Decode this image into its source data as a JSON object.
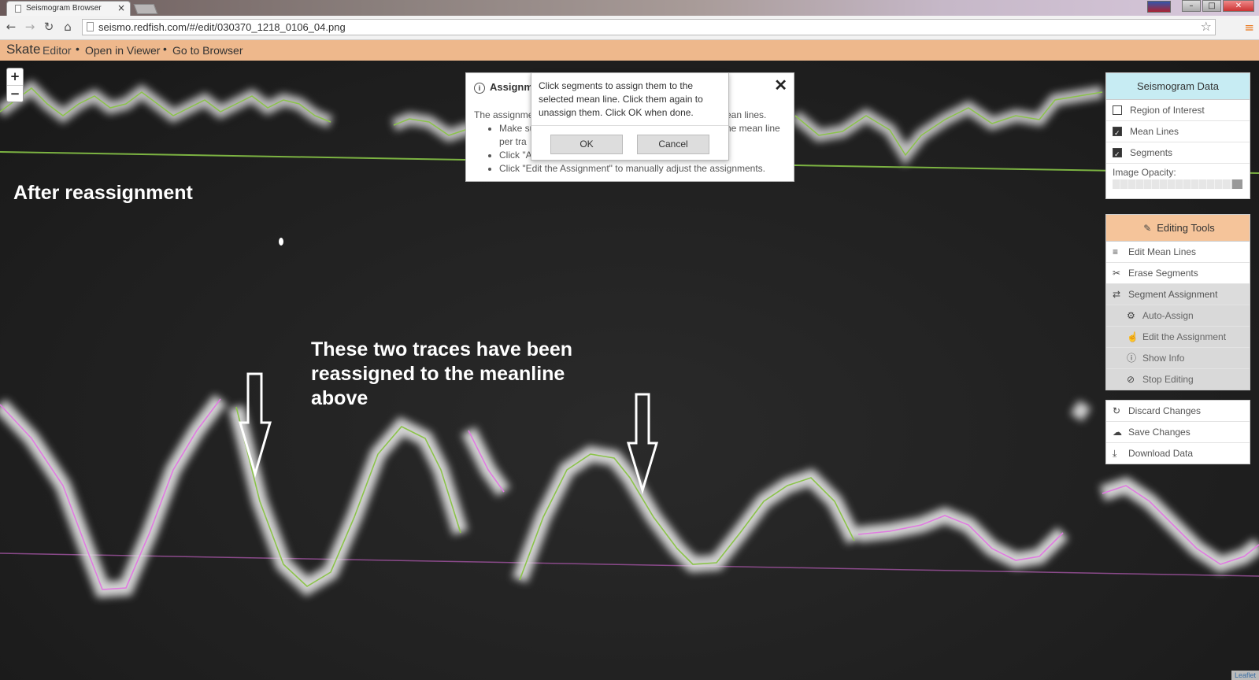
{
  "browser": {
    "tab_title": "Seismogram Browser",
    "url": "seismo.redfish.com/#/edit/030370_1218_0106_04.png"
  },
  "app": {
    "brand": "Skate",
    "brand_sub": "Editor",
    "links": [
      "Open in Viewer",
      "Go to Browser"
    ],
    "separator": "•",
    "accent_color": "#eeb88c"
  },
  "map": {
    "zoom_in": "+",
    "zoom_out": "−",
    "attribution": "Leaflet",
    "annotation_top": "After reassignment",
    "annotation_bottom": "These two traces have been reassigned to the meanline above"
  },
  "info_dialog": {
    "title": "Assignme",
    "intro_left": "The assignme",
    "intro_right": "ean lines.",
    "bullets": [
      "Make su",
      "per tra",
      "Click \"A",
      "Click \"Edit the Assignment\" to manually adjust the assignments."
    ],
    "extra": "ne mean line",
    "close": "✕"
  },
  "popup": {
    "message": "Click segments to assign them to the selected mean line. Click them again to unassign them. Click OK when done.",
    "ok_label": "OK",
    "cancel_label": "Cancel"
  },
  "seismogram_panel": {
    "title": "Seismogram Data",
    "header_color": "#c7ecf3",
    "options": [
      {
        "label": "Region of Interest",
        "checked": false
      },
      {
        "label": "Mean Lines",
        "checked": true
      },
      {
        "label": "Segments",
        "checked": true
      }
    ],
    "opacity_label": "Image Opacity:",
    "opacity_value": 1.0
  },
  "editing_panel": {
    "title": "Editing Tools",
    "header_color": "#f5c49a",
    "items": [
      {
        "label": "Edit Mean Lines",
        "icon": "list-icon"
      },
      {
        "label": "Erase Segments",
        "icon": "scissors-icon"
      },
      {
        "label": "Segment Assignment",
        "icon": "swap-icon"
      }
    ],
    "sub_items": [
      {
        "label": "Auto-Assign",
        "icon": "gear-icon"
      },
      {
        "label": "Edit the Assignment",
        "icon": "hand-icon"
      },
      {
        "label": "Show Info",
        "icon": "info-icon"
      },
      {
        "label": "Stop Editing",
        "icon": "ban-icon"
      }
    ]
  },
  "actions_panel": {
    "items": [
      {
        "label": "Discard Changes",
        "icon": "refresh-icon"
      },
      {
        "label": "Save Changes",
        "icon": "cloud-icon"
      },
      {
        "label": "Download Data",
        "icon": "download-icon"
      }
    ]
  }
}
